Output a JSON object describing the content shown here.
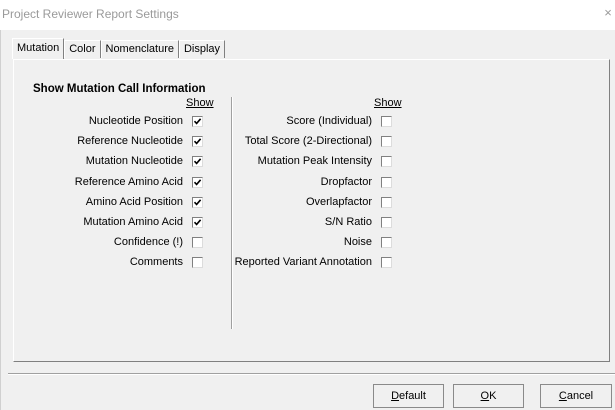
{
  "window": {
    "title": "Project Reviewer Report Settings",
    "close_glyph": "×"
  },
  "tabs": [
    {
      "label": "Mutation",
      "active": true
    },
    {
      "label": "Color",
      "active": false
    },
    {
      "label": "Nomenclature",
      "active": false
    },
    {
      "label": "Display",
      "active": false
    }
  ],
  "section": {
    "title": "Show Mutation Call Information",
    "left_column_header": "Show",
    "right_column_header": "Show"
  },
  "left_items": [
    {
      "label": "Nucleotide Position",
      "checked": true
    },
    {
      "label": "Reference Nucleotide",
      "checked": true
    },
    {
      "label": "Mutation Nucleotide",
      "checked": true
    },
    {
      "label": "Reference Amino Acid",
      "checked": true
    },
    {
      "label": "Amino Acid Position",
      "checked": true
    },
    {
      "label": "Mutation Amino Acid",
      "checked": true
    },
    {
      "label": "Confidence (!)",
      "checked": false
    },
    {
      "label": "Comments",
      "checked": false
    }
  ],
  "right_items": [
    {
      "label": "Score (Individual)",
      "checked": false
    },
    {
      "label": "Total Score (2-Directional)",
      "checked": false
    },
    {
      "label": "Mutation Peak Intensity",
      "checked": false
    },
    {
      "label": "Dropfactor",
      "checked": false
    },
    {
      "label": "Overlapfactor",
      "checked": false
    },
    {
      "label": "S/N Ratio",
      "checked": false
    },
    {
      "label": "Noise",
      "checked": false
    },
    {
      "label": "Reported Variant Annotation",
      "checked": false
    }
  ],
  "buttons": {
    "default": {
      "label": "Default",
      "mnemonic": "D",
      "rest": "efault"
    },
    "ok": {
      "label": "OK",
      "mnemonic": "O",
      "rest": "K"
    },
    "cancel": {
      "label": "Cancel",
      "mnemonic": "C",
      "rest": "ancel"
    }
  }
}
